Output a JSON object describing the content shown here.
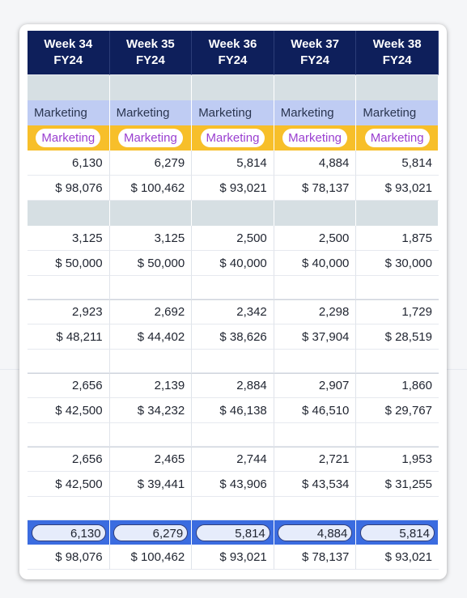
{
  "headers": [
    {
      "week": "Week 34",
      "fy": "FY24"
    },
    {
      "week": "Week 35",
      "fy": "FY24"
    },
    {
      "week": "Week 36",
      "fy": "FY24"
    },
    {
      "week": "Week 37",
      "fy": "FY24"
    },
    {
      "week": "Week 38",
      "fy": "FY24"
    }
  ],
  "marketing_label": "Marketing",
  "marketing_pill": "Marketing",
  "rows": {
    "r1_count": [
      "6,130",
      "6,279",
      "5,814",
      "4,884",
      "5,814"
    ],
    "r1_value": [
      "$ 98,076",
      "$ 100,462",
      "$ 93,021",
      "$ 78,137",
      "$ 93,021"
    ],
    "r2_count": [
      "3,125",
      "3,125",
      "2,500",
      "2,500",
      "1,875"
    ],
    "r2_value": [
      "$ 50,000",
      "$ 50,000",
      "$ 40,000",
      "$ 40,000",
      "$ 30,000"
    ],
    "r3_count": [
      "2,923",
      "2,692",
      "2,342",
      "2,298",
      "1,729"
    ],
    "r3_value": [
      "$ 48,211",
      "$ 44,402",
      "$ 38,626",
      "$ 37,904",
      "$ 28,519"
    ],
    "r4_count": [
      "2,656",
      "2,139",
      "2,884",
      "2,907",
      "1,860"
    ],
    "r4_value": [
      "$ 42,500",
      "$ 34,232",
      "$ 46,138",
      "$ 46,510",
      "$ 29,767"
    ],
    "r5_count": [
      "2,656",
      "2,465",
      "2,744",
      "2,721",
      "1,953"
    ],
    "r5_value": [
      "$ 42,500",
      "$ 39,441",
      "$ 43,906",
      "$ 43,534",
      "$ 31,255"
    ],
    "total_count": [
      "6,130",
      "6,279",
      "5,814",
      "4,884",
      "5,814"
    ],
    "total_value": [
      "$ 98,076",
      "$ 100,462",
      "$ 93,021",
      "$ 78,137",
      "$ 93,021"
    ]
  },
  "colors": {
    "header_bg": "#0e1f5b",
    "marketing_row_bg": "#bfccf3",
    "pill_row_bg": "#f7bf2a",
    "pill_text": "#9a3fd0",
    "total_row_bg": "#3b6ce0",
    "section_gray": "#d6dfe3"
  }
}
